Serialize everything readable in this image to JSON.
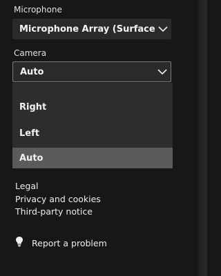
{
  "microphone": {
    "label": "Microphone",
    "selected": "Microphone Array (Surface Hu..."
  },
  "camera": {
    "label": "Camera",
    "selected": "Auto",
    "options": [
      {
        "label": "Right"
      },
      {
        "label": "Left"
      },
      {
        "label": "Auto",
        "selected": true
      }
    ]
  },
  "links": {
    "legal": "Legal",
    "privacy": "Privacy and cookies",
    "third_party": "Third-party notice"
  },
  "report": {
    "label": "Report a problem",
    "icon": "lightbulb-icon"
  }
}
